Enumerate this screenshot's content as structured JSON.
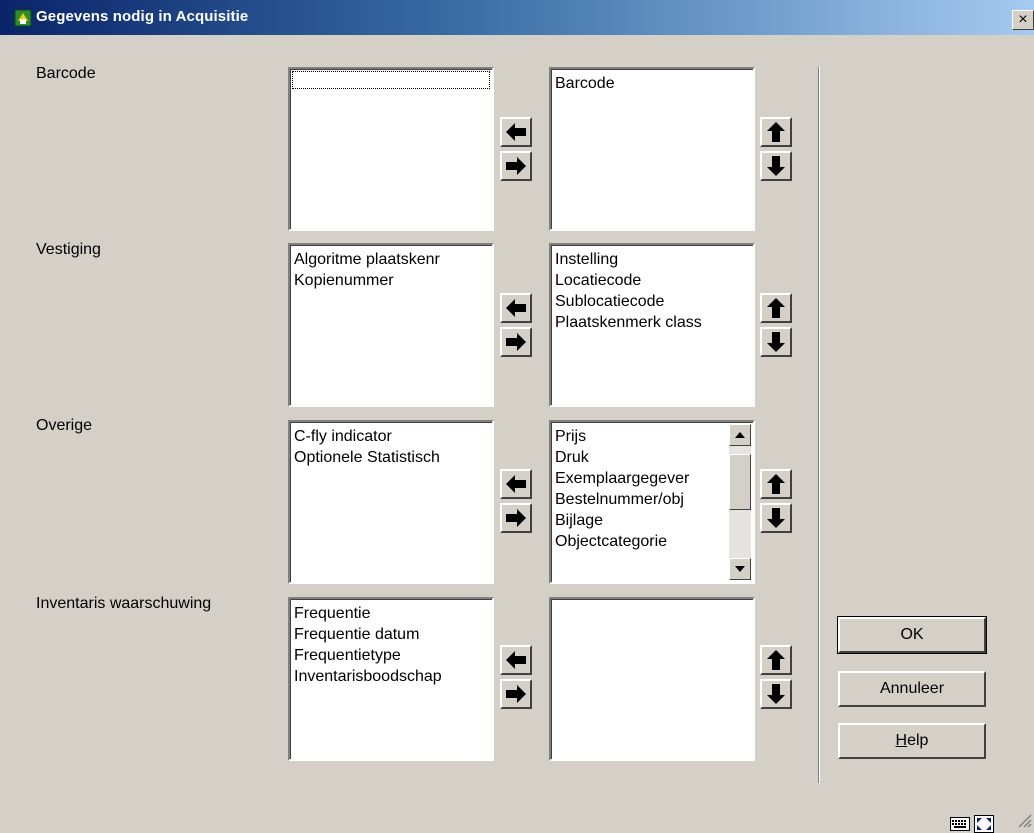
{
  "window": {
    "title": "Gegevens nodig in Acquisitie",
    "close_label": "×"
  },
  "rows": [
    {
      "label": "Barcode",
      "available": [],
      "selected": [
        "Barcode"
      ]
    },
    {
      "label": "Vestiging",
      "available": [
        "Algoritme plaatskenr",
        "Kopienummer"
      ],
      "selected": [
        "Instelling",
        "Locatiecode",
        "Sublocatiecode",
        "Plaatskenmerk class"
      ]
    },
    {
      "label": "Overige",
      "available": [
        "C-fly indicator",
        "Optionele Statistisch"
      ],
      "selected": [
        "Prijs",
        "Druk",
        "Exemplaargegever",
        "Bestelnummer/obj",
        "Bijlage",
        "Objectcategorie"
      ]
    },
    {
      "label": "Inventaris waarschuwing",
      "available": [
        "Frequentie",
        "Frequentie datum",
        "Frequentietype",
        "Inventarisboodschap"
      ],
      "selected": []
    }
  ],
  "buttons": {
    "ok": "OK",
    "cancel": "Annuleer",
    "help": "Help"
  },
  "icons": {
    "move_left": "arrow-left-icon",
    "move_right": "arrow-right-icon",
    "move_up": "arrow-up-icon",
    "move_down": "arrow-down-icon",
    "status_1": "keyboard-icon",
    "status_2": "resize-icon"
  }
}
